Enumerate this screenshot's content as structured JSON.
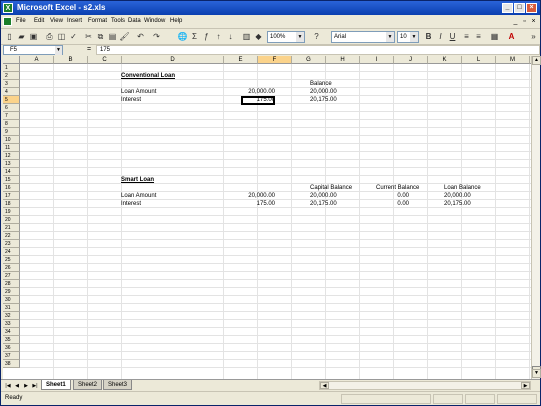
{
  "window": {
    "title": "Microsoft Excel - s2.xls",
    "title_bar_color": "#0a3fb0"
  },
  "menu": {
    "items": [
      "File",
      "Edit",
      "View",
      "Insert",
      "Format",
      "Tools",
      "Data",
      "Window",
      "Help"
    ]
  },
  "toolbar": {
    "zoom": "100%",
    "font": "Arial",
    "font_size": "10"
  },
  "formula_bar": {
    "name_box": "F5",
    "fx": "=",
    "value": "175"
  },
  "columns": [
    "A",
    "B",
    "C",
    "D",
    "E",
    "F",
    "G",
    "H",
    "I",
    "J",
    "K",
    "L",
    "M",
    "N"
  ],
  "rows": [
    "1",
    "2",
    "3",
    "4",
    "5",
    "6",
    "7",
    "8",
    "9",
    "10",
    "11",
    "12",
    "13",
    "14",
    "15",
    "16",
    "17",
    "18",
    "19",
    "20",
    "21",
    "22",
    "23",
    "24",
    "25",
    "26",
    "27",
    "28",
    "29",
    "30",
    "31",
    "32",
    "33",
    "34",
    "35",
    "36",
    "37",
    "38"
  ],
  "selected": {
    "column": "F",
    "row": "5"
  },
  "cells": {
    "d2": "Conventional Loan",
    "h3": "Balance",
    "d4": "Loan Amount",
    "f4": "20,000.00",
    "h4": "20,000.00",
    "d5": "Interest",
    "f5": "175.00",
    "h5": "20,175.00",
    "d14": "Smart Loan",
    "h15": "Capital Balance",
    "j15": "Current Balance",
    "l15": "Loan Balance",
    "d16": "Loan Amount",
    "f16": "20,000.00",
    "h16": "20,000.00",
    "j16": "0.00",
    "l16": "20,000.00",
    "d17": "Interest",
    "f17": "175.00",
    "h17": "20,175.00",
    "j17": "0.00",
    "l17": "20,175.00"
  },
  "sheets": [
    "Sheet1",
    "Sheet2",
    "Sheet3"
  ],
  "status": "Ready"
}
